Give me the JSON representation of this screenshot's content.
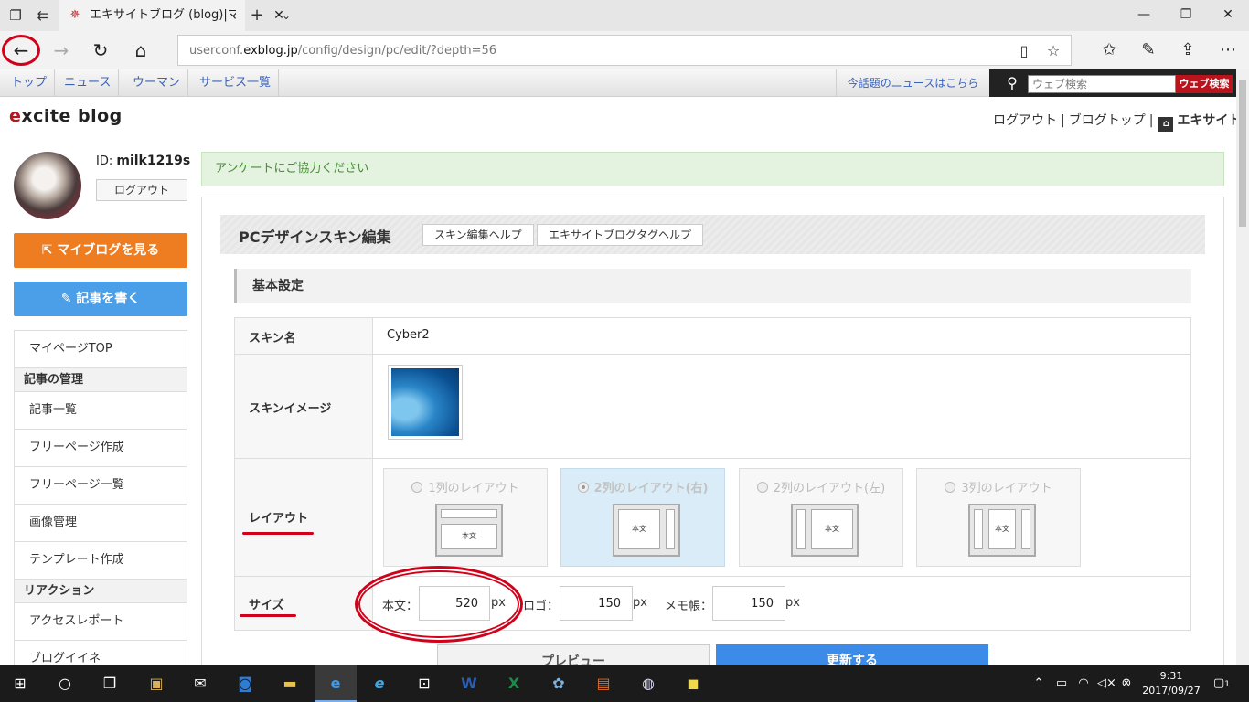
{
  "browser": {
    "tab_title": "エキサイトブログ (blog)|マイ",
    "url_prefix": "userconf.",
    "url_host": "exblog.jp",
    "url_path": "/config/design/pc/edit/?depth=56"
  },
  "site_nav": {
    "links": [
      "トップ",
      "ニュース",
      "ウーマン",
      "サービス一覧"
    ],
    "news_link": "今話題のニュースはこちら",
    "search_placeholder": "ウェブ検索",
    "search_button": "ウェブ検索"
  },
  "header": {
    "logo_e": "e",
    "logo_rest": "xcite blog",
    "logout": "ログアウト",
    "sep1": "|",
    "blog_top": "ブログトップ",
    "sep2": "|",
    "excite": "エキサイト"
  },
  "user": {
    "id_label": "ID:",
    "id_value": "milk1219s",
    "logout_button": "ログアウト"
  },
  "sidebar": {
    "my_blog_button": "マイブログを見る",
    "write_button": "記事を書く",
    "mypage_top": "マイページTOP",
    "section_articles": "記事の管理",
    "articles_items": [
      "記事一覧",
      "フリーページ作成",
      "フリーページ一覧",
      "画像管理",
      "テンプレート作成"
    ],
    "section_reaction": "リアクション",
    "reaction_items": [
      "アクセスレポート",
      "ブログイイネ"
    ]
  },
  "notice": "アンケートにご協力ください",
  "panel": {
    "title": "PCデザインスキン編集",
    "help_skin": "スキン編集ヘルプ",
    "help_tag": "エキサイトブログタグヘルプ",
    "section": "基本設定"
  },
  "form": {
    "skin_name_label": "スキン名",
    "skin_name_value": "Cyber2",
    "skin_image_label": "スキンイメージ",
    "layout_label": "レイアウト",
    "layouts": [
      {
        "label": "1列のレイアウト",
        "body": "本文"
      },
      {
        "label": "2列のレイアウト(右)",
        "body": "本文"
      },
      {
        "label": "2列のレイアウト(左)",
        "body": "本文"
      },
      {
        "label": "3列のレイアウト",
        "body": "本文"
      }
    ],
    "selected_layout": "2列のレイアウト(右)",
    "size_label": "サイズ",
    "body_label": "本文：",
    "body_value": "520",
    "logo_label": "ロゴ：",
    "logo_value": "150",
    "memo_label": "メモ帳：",
    "memo_value": "150",
    "unit": "px"
  },
  "buttons": {
    "preview": "プレビュー",
    "update": "更新する"
  },
  "taskbar": {
    "time": "9:31",
    "date": "2017/09/27",
    "notification_count": "1"
  },
  "colors": {
    "accent_orange": "#ee7d21",
    "accent_blue": "#4b9ee8",
    "annotation_red": "#d0021b",
    "notice_green": "#e3f3df"
  }
}
